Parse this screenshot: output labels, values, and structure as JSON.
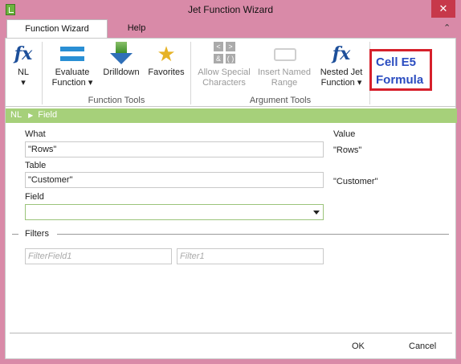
{
  "window": {
    "title": "Jet Function Wizard",
    "close_glyph": "✕",
    "collapse_glyph": "⌃"
  },
  "tabs": [
    {
      "label": "Function Wizard",
      "active": true
    },
    {
      "label": "Help",
      "active": false
    }
  ],
  "ribbon": {
    "buttons": [
      {
        "label1": "NL",
        "label2": "▾",
        "icon": "fx-icon"
      },
      {
        "label1": "Evaluate",
        "label2": "Function ▾",
        "icon": "evaluate-icon"
      },
      {
        "label1": "Drilldown",
        "label2": "",
        "icon": "drilldown-icon"
      },
      {
        "label1": "Favorites",
        "label2": "",
        "icon": "favorites-star-icon"
      },
      {
        "label1": "Allow Special",
        "label2": "Characters",
        "icon": "special-characters-icon",
        "disabled": true
      },
      {
        "label1": "Insert Named",
        "label2": "Range",
        "icon": "named-range-icon",
        "disabled": true
      },
      {
        "label1": "Nested Jet",
        "label2": "Function ▾",
        "icon": "nested-fx-icon"
      }
    ],
    "groups": {
      "function_tools": "Function Tools",
      "argument_tools": "Argument Tools"
    },
    "fx_glyph": "fx",
    "special_chars": [
      "<",
      ">",
      "&",
      "( )"
    ]
  },
  "annotation": {
    "line1": "Cell E5",
    "line2": "Formula"
  },
  "breadcrumb": {
    "root": "NL",
    "separator": "▶",
    "current": "Field"
  },
  "form": {
    "value_header": "Value",
    "what": {
      "label": "What",
      "value": "\"Rows\"",
      "preview": "\"Rows\""
    },
    "table": {
      "label": "Table",
      "value": "\"Customer\"",
      "preview": "\"Customer\""
    },
    "field": {
      "label": "Field",
      "value": ""
    },
    "filters": {
      "label": "Filters",
      "filter_field_placeholder": "FilterField1",
      "filter_placeholder": "Filter1"
    }
  },
  "footer": {
    "ok": "OK",
    "cancel": "Cancel"
  },
  "colors": {
    "accent_green": "#a6d07a",
    "annotation_red": "#d6202b",
    "annotation_text": "#2a4cc0",
    "titlebar": "#d98aa8"
  }
}
